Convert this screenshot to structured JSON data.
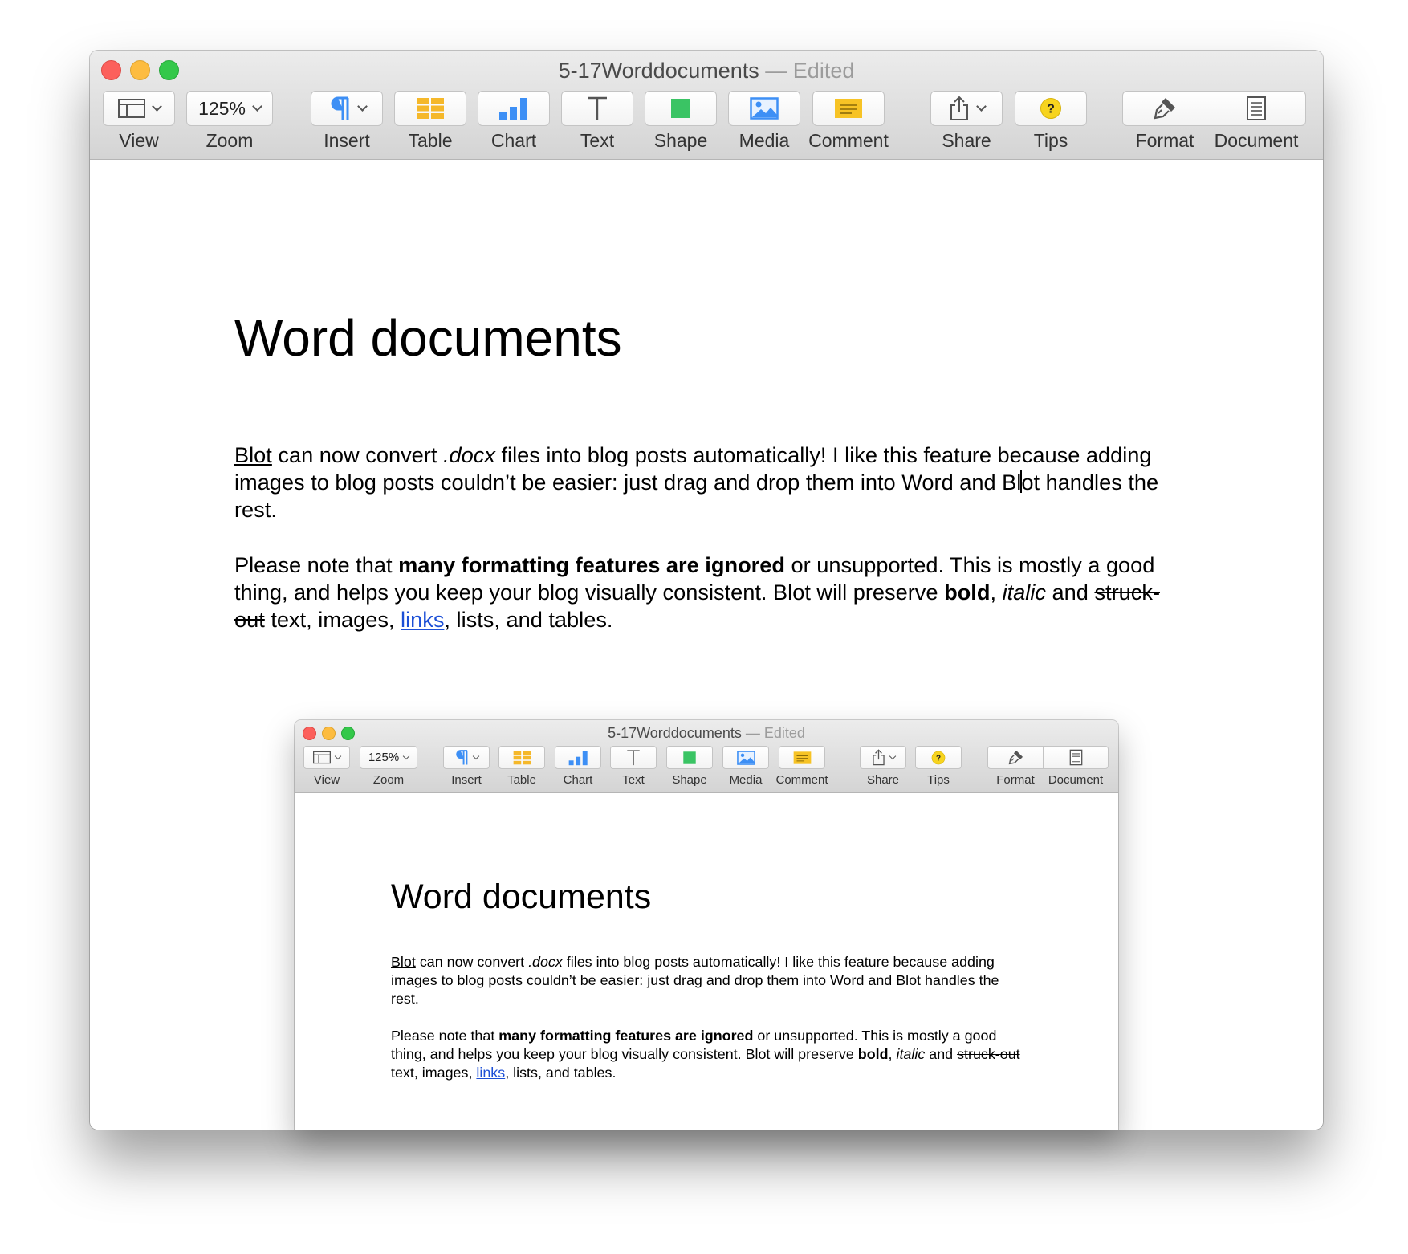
{
  "window": {
    "title": "5-17Worddocuments",
    "title_separator": "—",
    "status": "Edited"
  },
  "toolbar": {
    "view_label": "View",
    "zoom_value": "125%",
    "zoom_label": "Zoom",
    "insert_label": "Insert",
    "table_label": "Table",
    "chart_label": "Chart",
    "text_label": "Text",
    "shape_label": "Shape",
    "media_label": "Media",
    "comment_label": "Comment",
    "share_label": "Share",
    "tips_label": "Tips",
    "format_label": "Format",
    "document_label": "Document"
  },
  "icons": {
    "view": "view-layout-icon",
    "insert": "pilcrow-icon",
    "table": "table-icon",
    "chart": "bar-chart-icon",
    "text": "text-t-icon",
    "shape": "square-shape-icon",
    "media": "image-icon",
    "comment": "comment-note-icon",
    "share": "share-upload-icon",
    "tips": "question-tips-icon",
    "format": "paintbrush-icon",
    "document": "document-page-icon"
  },
  "colors": {
    "insert_icon": "#3d8ff5",
    "table_icon": "#f5b82a",
    "chart_icon": "#3d8ff5",
    "shape_icon": "#3ac464",
    "media_icon": "#3d8ff5",
    "comment_icon": "#f7c325",
    "tips_icon": "#f7d41e",
    "link": "#1c4fd6"
  },
  "document": {
    "title": "Word documents",
    "p1": {
      "blot_link": "Blot",
      "t1": " can now convert ",
      "docx": ".docx",
      "t2": " files into blog posts automatically! I like this feature because adding images to blog posts couldn’t be easier: just drag and drop them into Word and Bl",
      "t3": "ot handles the rest."
    },
    "p2": {
      "t1": "Please note that ",
      "bold1": "many formatting features are ignored",
      "t2": " or unsupported. This is mostly a good thing, and helps you keep your blog visually consistent. Blot will preserve ",
      "bold2": "bold",
      "t3": ", ",
      "italic": "italic",
      "t4": " and ",
      "strike": "struck-out",
      "t5": " text, images, ",
      "link": "links",
      "t6": ", lists, and tables."
    }
  }
}
